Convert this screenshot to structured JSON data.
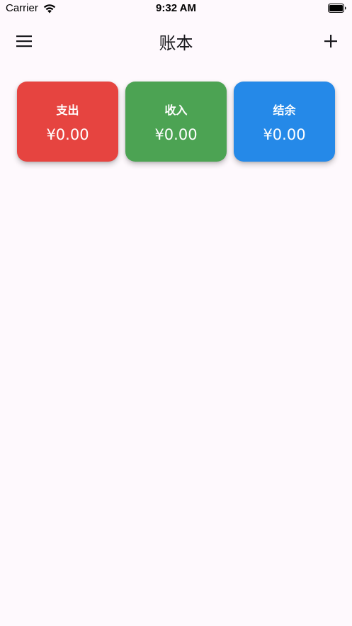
{
  "status_bar": {
    "carrier": "Carrier",
    "time": "9:32 AM",
    "wifi_icon": "wifi-icon",
    "battery_icon": "battery-full-icon"
  },
  "app_bar": {
    "title": "账本",
    "menu_icon": "hamburger-menu-icon",
    "add_icon": "plus-icon"
  },
  "summary": {
    "expense": {
      "label": "支出",
      "amount": "¥0.00",
      "color": "#E64440"
    },
    "income": {
      "label": "收入",
      "amount": "¥0.00",
      "color": "#4CA353"
    },
    "balance": {
      "label": "结余",
      "amount": "¥0.00",
      "color": "#2589E8"
    }
  },
  "colors": {
    "background": "#FEF9FD",
    "text": "#1B1B1F"
  }
}
